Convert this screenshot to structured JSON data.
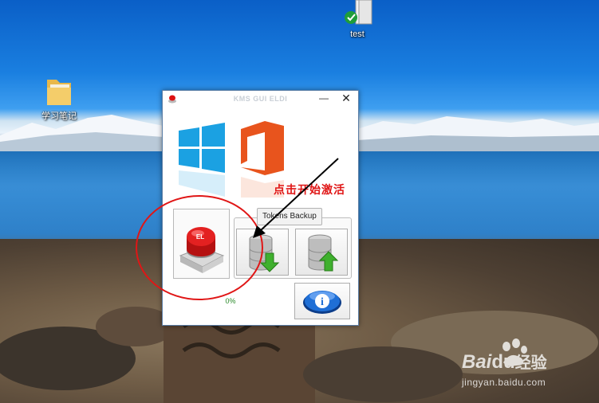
{
  "desktop": {
    "icons": [
      {
        "label": "test",
        "icon": "shortcut-folder-check-icon"
      },
      {
        "label": "学习笔记",
        "icon": "folder-icon"
      }
    ]
  },
  "window": {
    "title": "KMS GUI ELDI",
    "app_icon": "red-button-icon",
    "minimize_glyph": "—",
    "close_glyph": "✕",
    "activate_button": {
      "icon": "red-el-push-button-icon",
      "badge": "EL"
    },
    "progress_text": "0%",
    "tokens_backup": {
      "label": "Tokens Backup",
      "buttons": [
        {
          "icon": "database-download-icon"
        },
        {
          "icon": "database-upload-icon"
        }
      ]
    },
    "info_button": {
      "icon": "info-icon",
      "glyph": "i"
    }
  },
  "annotation": {
    "text": "点击开始激活",
    "color": "#e01616"
  },
  "watermark": {
    "brand_prefix": "Bai",
    "brand_du": "du",
    "brand_suffix": "经验",
    "url": "jingyan.baidu.com"
  },
  "colors": {
    "windows_logo": "#1ba1e2",
    "office_logo": "#e8541d",
    "annotation_red": "#e01616",
    "progress_green": "#2a8a2a"
  }
}
